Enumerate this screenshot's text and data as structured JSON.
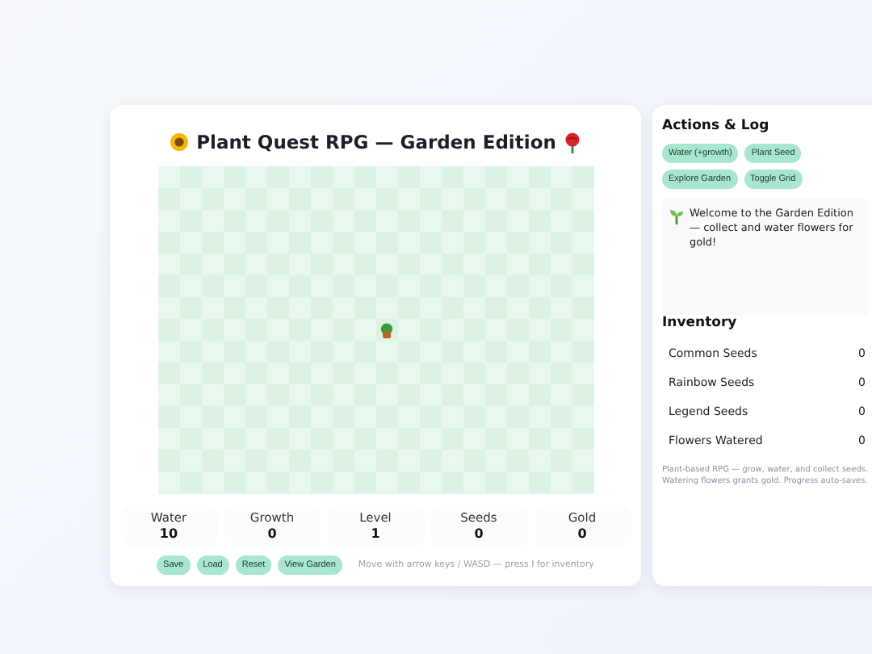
{
  "game": {
    "title": "Plant Quest RPG — Garden Edition",
    "stats": [
      {
        "label": "Water",
        "value": "10"
      },
      {
        "label": "Growth",
        "value": "0"
      },
      {
        "label": "Level",
        "value": "1"
      },
      {
        "label": "Seeds",
        "value": "0"
      },
      {
        "label": "Gold",
        "value": "0"
      }
    ],
    "buttons": [
      "Save",
      "Load",
      "Reset",
      "View Garden"
    ],
    "hint": "Move with arrow keys / WASD — press I for inventory"
  },
  "actions": {
    "title": "Actions & Log",
    "buttons": [
      "Water (+growth)",
      "Plant Seed",
      "Explore Garden",
      "Toggle Grid"
    ],
    "log": "Welcome to the Garden Edition — collect and water flowers for gold!"
  },
  "inventory": {
    "title": "Inventory",
    "items": [
      {
        "name": "Common Seeds",
        "count": "0"
      },
      {
        "name": "Rainbow Seeds",
        "count": "0"
      },
      {
        "name": "Legend Seeds",
        "count": "0"
      },
      {
        "name": "Flowers Watered",
        "count": "0"
      }
    ],
    "footnote": "Plant-based RPG — grow, water, and collect seeds. Watering flowers grants gold. Progress auto-saves."
  }
}
